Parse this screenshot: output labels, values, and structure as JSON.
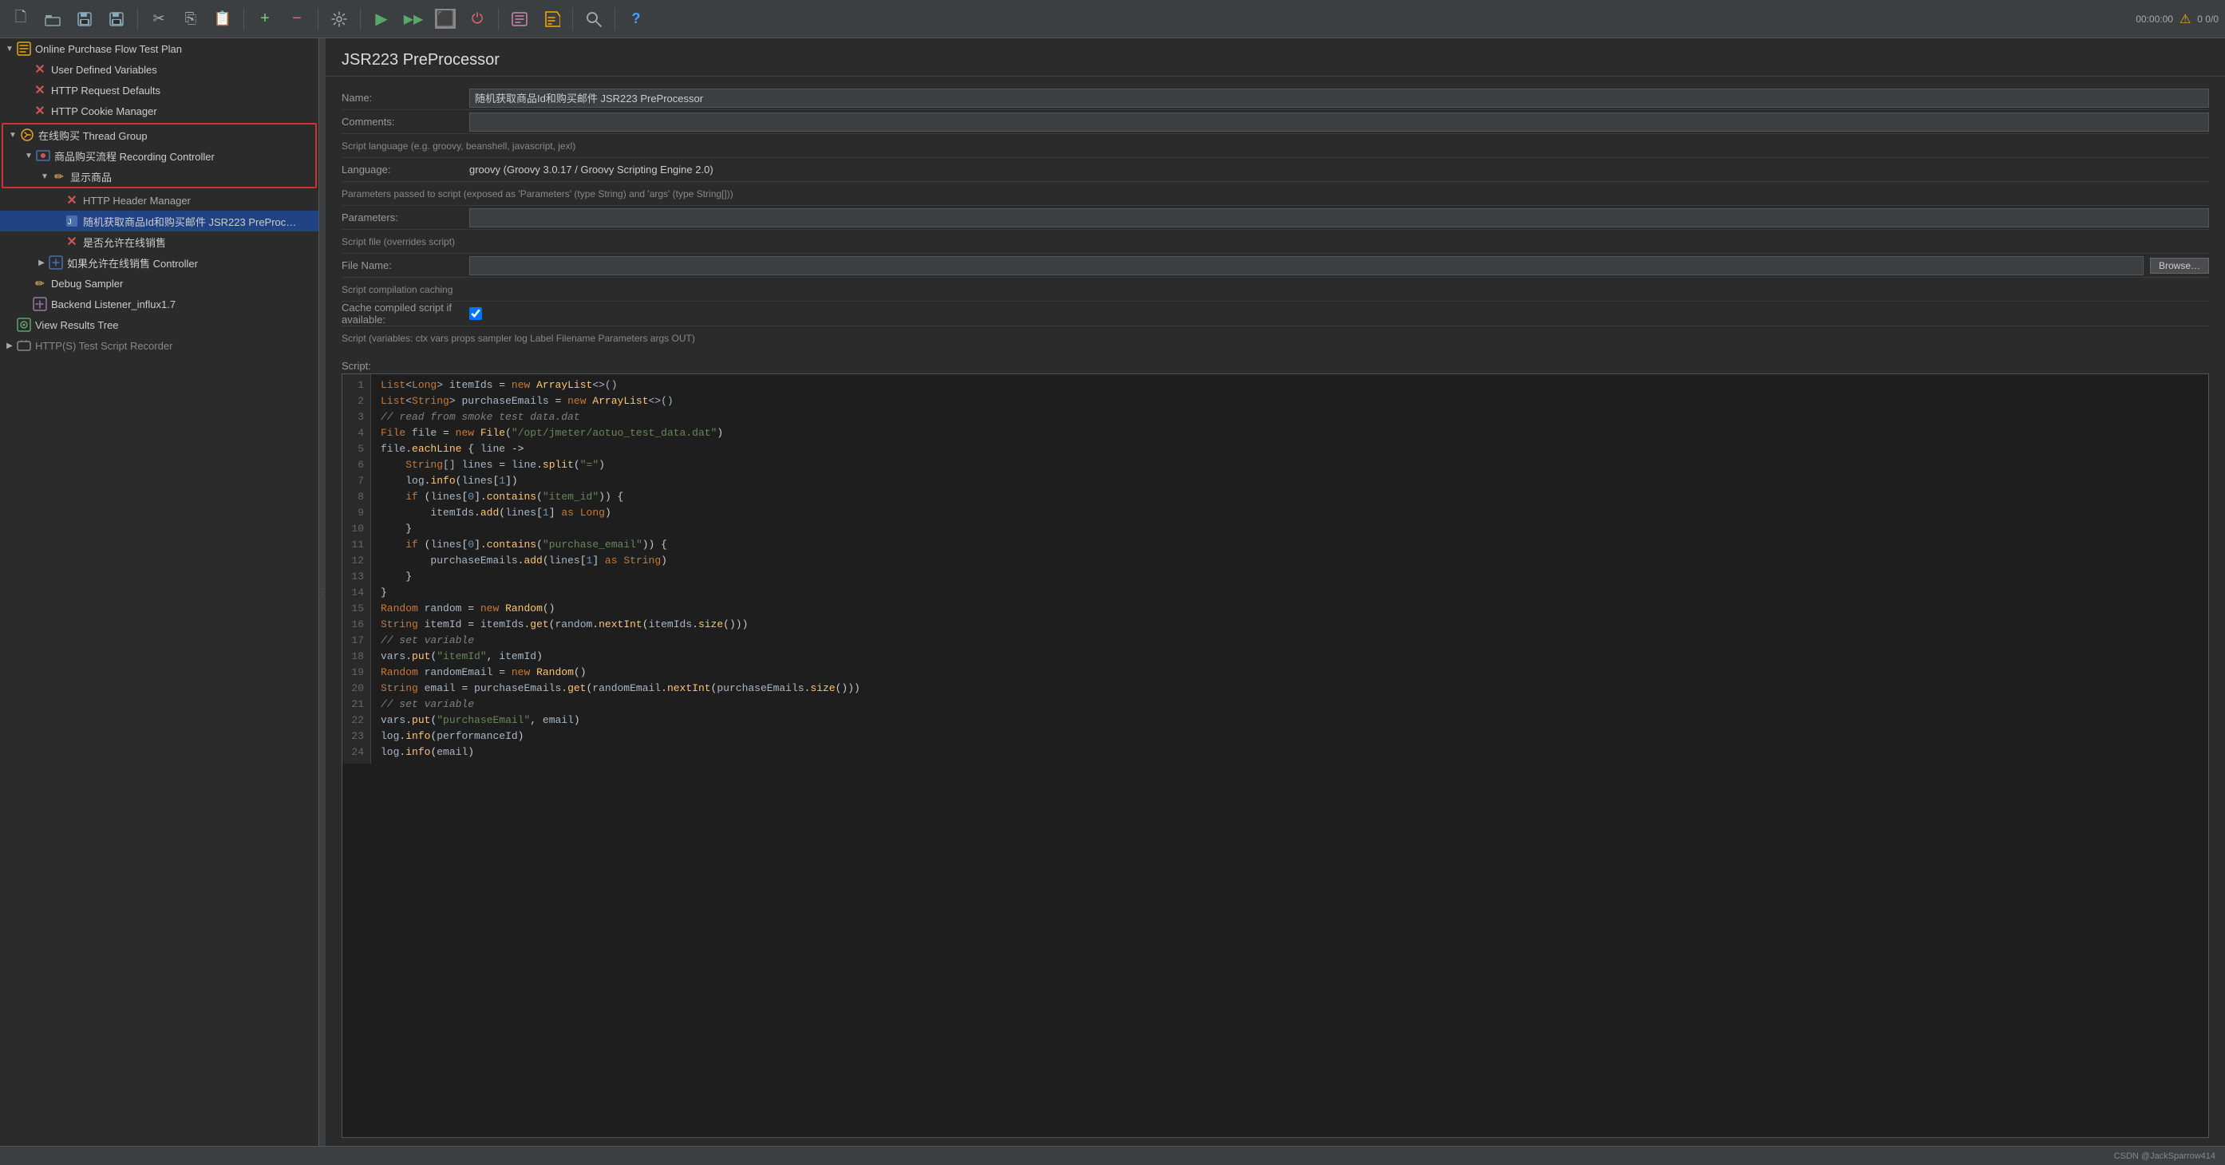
{
  "toolbar": {
    "buttons": [
      {
        "name": "new-btn",
        "icon": "🗋",
        "label": "New"
      },
      {
        "name": "open-btn",
        "icon": "📂",
        "label": "Open"
      },
      {
        "name": "save-btn",
        "icon": "💾",
        "label": "Save"
      },
      {
        "name": "save-as-btn",
        "icon": "💾",
        "label": "Save As"
      },
      {
        "name": "cut-btn",
        "icon": "✂",
        "label": "Cut"
      },
      {
        "name": "copy-btn",
        "icon": "📋",
        "label": "Copy"
      },
      {
        "name": "paste-btn",
        "icon": "📌",
        "label": "Paste"
      },
      {
        "name": "add-btn",
        "icon": "+",
        "label": "Add"
      },
      {
        "name": "remove-btn",
        "icon": "−",
        "label": "Remove"
      },
      {
        "name": "clear-btn",
        "icon": "🔧",
        "label": "Clear"
      },
      {
        "name": "start-btn",
        "icon": "▶",
        "label": "Start"
      },
      {
        "name": "start-no-pause-btn",
        "icon": "▶▶",
        "label": "Start no pause"
      },
      {
        "name": "stop-btn",
        "icon": "⬛",
        "label": "Stop"
      },
      {
        "name": "shutdown-btn",
        "icon": "⭕",
        "label": "Shutdown"
      },
      {
        "name": "help-btn",
        "icon": "?",
        "label": "Help"
      }
    ],
    "status_time": "00:00:00",
    "status_warnings": "0  0/0"
  },
  "left_panel": {
    "tree_items": [
      {
        "id": "test-plan",
        "label": "Online Purchase Flow Test Plan",
        "indent": 0,
        "icon": "📋",
        "expanded": true,
        "selected": false
      },
      {
        "id": "user-vars",
        "label": "User Defined Variables",
        "indent": 1,
        "icon": "✕",
        "expanded": false,
        "selected": false
      },
      {
        "id": "http-defaults",
        "label": "HTTP Request Defaults",
        "indent": 1,
        "icon": "✕",
        "expanded": false,
        "selected": false
      },
      {
        "id": "cookie-manager",
        "label": "HTTP Cookie Manager",
        "indent": 1,
        "icon": "✕",
        "expanded": false,
        "selected": false
      },
      {
        "id": "thread-group",
        "label": "在线购买 Thread Group",
        "indent": 1,
        "icon": "⚙",
        "expanded": true,
        "selected": false,
        "highlighted": true
      },
      {
        "id": "recording-ctrl",
        "label": "商品购买流程 Recording Controller",
        "indent": 2,
        "icon": "🎬",
        "expanded": true,
        "selected": false,
        "highlighted": true
      },
      {
        "id": "display-goods",
        "label": "显示商品",
        "indent": 3,
        "icon": "✏",
        "expanded": true,
        "selected": false,
        "highlighted": true
      },
      {
        "id": "http-header",
        "label": "HTTP Header Manager",
        "indent": 4,
        "icon": "✕",
        "expanded": false,
        "selected": false
      },
      {
        "id": "jsr223-pre",
        "label": "随机获取商品Id和购买邮件 JSR223 PreProc…",
        "indent": 4,
        "icon": "📄",
        "expanded": false,
        "selected": true
      },
      {
        "id": "is-online",
        "label": "是否允许在线销售",
        "indent": 4,
        "icon": "✕",
        "expanded": false,
        "selected": false
      },
      {
        "id": "if-controller",
        "label": "如果允许在线销售 Controller",
        "indent": 3,
        "icon": "🔷",
        "expanded": false,
        "selected": false
      },
      {
        "id": "debug-sampler",
        "label": "Debug Sampler",
        "indent": 2,
        "icon": "✏",
        "expanded": false,
        "selected": false
      },
      {
        "id": "backend-listener",
        "label": "Backend Listener_influx1.7",
        "indent": 2,
        "icon": "📡",
        "expanded": false,
        "selected": false
      },
      {
        "id": "view-results",
        "label": "View Results Tree",
        "indent": 1,
        "icon": "👁",
        "expanded": false,
        "selected": false
      },
      {
        "id": "http-recorder",
        "label": "HTTP(S) Test Script Recorder",
        "indent": 1,
        "icon": "🖥",
        "expanded": false,
        "selected": false
      }
    ]
  },
  "right_panel": {
    "title": "JSR223 PreProcessor",
    "fields": {
      "name_label": "Name:",
      "name_value": "随机获取商品Id和购买邮件 JSR223 PreProcessor",
      "comments_label": "Comments:",
      "comments_value": "",
      "script_language_label": "Script language (e.g. groovy, beanshell, javascript, jexl)",
      "language_label": "Language:",
      "language_value": "groovy    (Groovy 3.0.17 / Groovy Scripting Engine 2.0)",
      "params_label": "Parameters passed to script (exposed as 'Parameters' (type String) and 'args' (type String[]))",
      "parameters_label": "Parameters:",
      "parameters_value": "",
      "script_file_label": "Script file (overrides script)",
      "file_name_label": "File Name:",
      "file_name_value": "",
      "browse_label": "Browse…",
      "cache_label": "Script compilation caching",
      "cache_checkbox_label": "Cache compiled script if available:",
      "cache_checked": true,
      "script_vars_label": "Script (variables: ctx vars props sampler log Label Filename Parameters args OUT)",
      "script_title": "Script:"
    },
    "script_lines": [
      {
        "num": 1,
        "code": "<span class='type'>List</span><span class='ident'>&lt;</span><span class='type'>Long</span><span class='ident'>&gt;</span> <span class='ident'>itemIds</span> = <span class='kw'>new</span> <span class='fn'>ArrayList</span><span class='ident'>&lt;&gt;()</span>"
      },
      {
        "num": 2,
        "code": "<span class='type'>List</span><span class='ident'>&lt;</span><span class='type'>String</span><span class='ident'>&gt;</span> <span class='ident'>purchaseEmails</span> = <span class='kw'>new</span> <span class='fn'>ArrayList</span><span class='ident'>&lt;&gt;()</span>"
      },
      {
        "num": 3,
        "code": "<span class='comment'>// read from smoke test data.dat</span>"
      },
      {
        "num": 4,
        "code": "<span class='type'>File</span> <span class='ident'>file</span> = <span class='kw'>new</span> <span class='fn'>File</span>(<span class='str'>\"/opt/jmeter/aotuo_test_data.dat\"</span>)"
      },
      {
        "num": 5,
        "code": "<span class='ident'>file</span>.<span class='fn'>eachLine</span> { <span class='ident'>line</span> -&gt;"
      },
      {
        "num": 6,
        "code": "    <span class='type'>String</span><span class='ident'>[]</span> <span class='ident'>lines</span> = <span class='ident'>line</span>.<span class='fn'>split</span>(<span class='str'>\"=\"</span>)"
      },
      {
        "num": 7,
        "code": "    <span class='ident'>log</span>.<span class='fn'>info</span>(<span class='ident'>lines</span>[<span class='num'>1</span>])"
      },
      {
        "num": 8,
        "code": "    <span class='kw'>if</span> (<span class='ident'>lines</span>[<span class='num'>0</span>].<span class='fn'>contains</span>(<span class='str'>\"item_id\"</span>)) {"
      },
      {
        "num": 9,
        "code": "        <span class='ident'>itemIds</span>.<span class='fn'>add</span>(<span class='ident'>lines</span>[<span class='num'>1</span>] <span class='kw'>as</span> <span class='type'>Long</span>)"
      },
      {
        "num": 10,
        "code": "    }"
      },
      {
        "num": 11,
        "code": "    <span class='kw'>if</span> (<span class='ident'>lines</span>[<span class='num'>0</span>].<span class='fn'>contains</span>(<span class='str'>\"purchase_email\"</span>)) {"
      },
      {
        "num": 12,
        "code": "        <span class='ident'>purchaseEmails</span>.<span class='fn'>add</span>(<span class='ident'>lines</span>[<span class='num'>1</span>] <span class='kw'>as</span> <span class='type'>String</span>)"
      },
      {
        "num": 13,
        "code": "    }"
      },
      {
        "num": 14,
        "code": "}"
      },
      {
        "num": 15,
        "code": "<span class='type'>Random</span> <span class='ident'>random</span> = <span class='kw'>new</span> <span class='fn'>Random</span>()"
      },
      {
        "num": 16,
        "code": "<span class='type'>String</span> <span class='ident'>itemId</span> = <span class='ident'>itemIds</span>.<span class='fn'>get</span>(<span class='ident'>random</span>.<span class='fn'>nextInt</span>(<span class='ident'>itemIds</span>.<span class='fn'>size</span>()))"
      },
      {
        "num": 17,
        "code": "<span class='comment'>// set variable</span>"
      },
      {
        "num": 18,
        "code": "<span class='ident'>vars</span>.<span class='fn'>put</span>(<span class='str'>\"itemId\"</span>, <span class='ident'>itemId</span>)"
      },
      {
        "num": 19,
        "code": "<span class='type'>Random</span> <span class='ident'>randomEmail</span> = <span class='kw'>new</span> <span class='fn'>Random</span>()"
      },
      {
        "num": 20,
        "code": "<span class='type'>String</span> <span class='ident'>email</span> = <span class='ident'>purchaseEmails</span>.<span class='fn'>get</span>(<span class='ident'>randomEmail</span>.<span class='fn'>nextInt</span>(<span class='ident'>purchaseEmails</span>.<span class='fn'>size</span>()))"
      },
      {
        "num": 21,
        "code": "<span class='comment'>// set variable</span>"
      },
      {
        "num": 22,
        "code": "<span class='ident'>vars</span>.<span class='fn'>put</span>(<span class='str'>\"purchaseEmail\"</span>, <span class='ident'>email</span>)"
      },
      {
        "num": 23,
        "code": "<span class='ident'>log</span>.<span class='fn'>info</span>(<span class='ident'>performanceId</span>)"
      },
      {
        "num": 24,
        "code": "<span class='ident'>log</span>.<span class='fn'>info</span>(<span class='ident'>email</span>)"
      }
    ]
  },
  "status_bar": {
    "text": "CSDN @JackSparrow414"
  }
}
